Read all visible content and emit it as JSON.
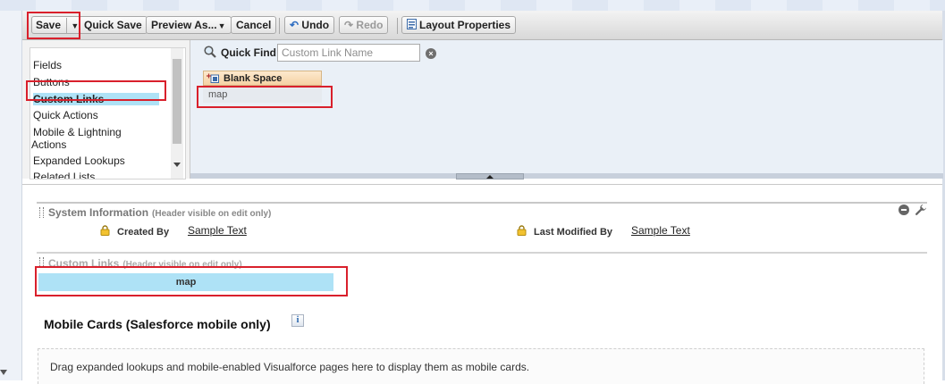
{
  "toolbar": {
    "save_label": "Save",
    "quick_save_label": "Quick Save",
    "preview_as_label": "Preview As...",
    "cancel_label": "Cancel",
    "undo_label": "Undo",
    "redo_label": "Redo",
    "layout_properties_label": "Layout Properties"
  },
  "palette": {
    "categories": [
      "Fields",
      "Buttons",
      "Custom Links",
      "Quick Actions",
      "Mobile & Lightning",
      "Actions",
      "Expanded Lookups",
      "Related Lists"
    ],
    "selected_category": "Custom Links",
    "quick_find_label": "Quick Find",
    "quick_find_placeholder": "Custom Link Name",
    "items": [
      "Blank Space",
      "map"
    ]
  },
  "layout": {
    "system_info": {
      "title": "System Information",
      "note": "(Header visible on edit only)",
      "created_by_label": "Created By",
      "created_by_value": "Sample Text",
      "last_modified_label": "Last Modified By",
      "last_modified_value": "Sample Text"
    },
    "custom_links": {
      "title": "Custom Links",
      "note": "(Header visible on edit only)",
      "item": "map"
    },
    "mobile_cards": {
      "title": "Mobile Cards (Salesforce mobile only)",
      "info_icon": "i",
      "drop_text": "Drag expanded lookups and mobile-enabled Visualforce pages here to display them as mobile cards."
    }
  },
  "colors": {
    "highlight_red": "#d9202c",
    "selected_blue": "#aee2f6",
    "palette_bg": "#eaf0f7"
  }
}
